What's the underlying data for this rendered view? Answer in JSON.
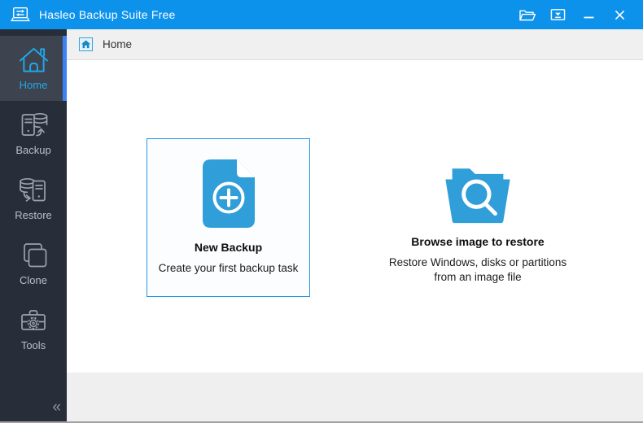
{
  "window": {
    "title": "Hasleo Backup Suite Free"
  },
  "titlebar": {
    "controls": [
      "open-image-file",
      "check-for-updates",
      "minimize",
      "close"
    ]
  },
  "sidebar": {
    "items": [
      {
        "label": "Home",
        "icon": "home-icon",
        "active": true
      },
      {
        "label": "Backup",
        "icon": "backup-icon",
        "active": false
      },
      {
        "label": "Restore",
        "icon": "restore-icon",
        "active": false
      },
      {
        "label": "Clone",
        "icon": "clone-icon",
        "active": false
      },
      {
        "label": "Tools",
        "icon": "tools-icon",
        "active": false
      }
    ],
    "collapse_glyph": "«"
  },
  "breadcrumb": {
    "label": "Home"
  },
  "cards": {
    "new_backup": {
      "title": "New Backup",
      "subtitle": "Create your first backup task"
    },
    "browse_restore": {
      "title": "Browse image to restore",
      "line1": "Restore Windows, disks or partitions",
      "line2": "from an image file"
    }
  },
  "colors": {
    "titlebar": "#0d92ec",
    "sidebar": "#272e39",
    "sidebar_active": "#3d4450",
    "accent_bar": "#3c82f4",
    "icon_active": "#22a7e8",
    "sidebar_text": "#b9bfc8",
    "sidebar_icon": "#9aa2ae",
    "header_bg": "#f0f0f0",
    "footer_bg": "#efefef",
    "card_border": "#2596e6",
    "card_bg": "#fbfdff",
    "doc_blue": "#2f9ed9"
  }
}
